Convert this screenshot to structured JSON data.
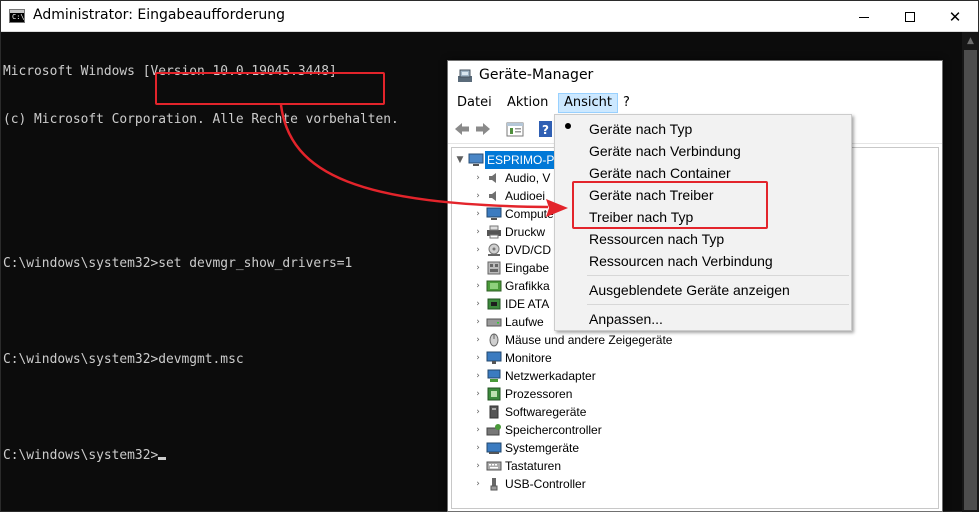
{
  "cmd": {
    "title": "Administrator: Eingabeaufforderung",
    "icon_text": "C:\\_",
    "lines": [
      "Microsoft Windows [Version 10.0.19045.3448]",
      "(c) Microsoft Corporation. Alle Rechte vorbehalten.",
      "",
      "C:\\windows\\system32>set devmgr_show_drivers=1",
      "",
      "C:\\windows\\system32>devmgmt.msc",
      "",
      "C:\\windows\\system32>"
    ],
    "minimize": "minimize-icon",
    "maximize": "maximize-icon",
    "close_glyph": "✕"
  },
  "devmgr": {
    "title": "Geräte-Manager",
    "menu": {
      "datei": "Datei",
      "aktion": "Aktion",
      "ansicht": "Ansicht",
      "help": "?"
    },
    "tree": {
      "root": "ESPRIMO-P",
      "items": [
        "Audio, V",
        "Audioei",
        "Compute",
        "Druckw",
        "DVD/CD",
        "Eingabe",
        "Grafikka",
        "IDE ATA",
        "Laufwe",
        "Mäuse und andere Zeigegeräte",
        "Monitore",
        "Netzwerkadapter",
        "Prozessoren",
        "Softwaregeräte",
        "Speichercontroller",
        "Systemgeräte",
        "Tastaturen",
        "USB-Controller"
      ]
    }
  },
  "dropdown": {
    "items": [
      "Geräte nach Typ",
      "Geräte nach Verbindung",
      "Geräte nach Container",
      "Geräte nach Treiber",
      "Treiber nach Typ",
      "Ressourcen nach Typ",
      "Ressourcen nach Verbindung",
      "Ausgeblendete Geräte anzeigen",
      "Anpassen..."
    ],
    "selected_index": 0
  },
  "colors": {
    "annotation": "#e3242b",
    "selection": "#0078d7",
    "menu_highlight": "#cce8ff"
  }
}
